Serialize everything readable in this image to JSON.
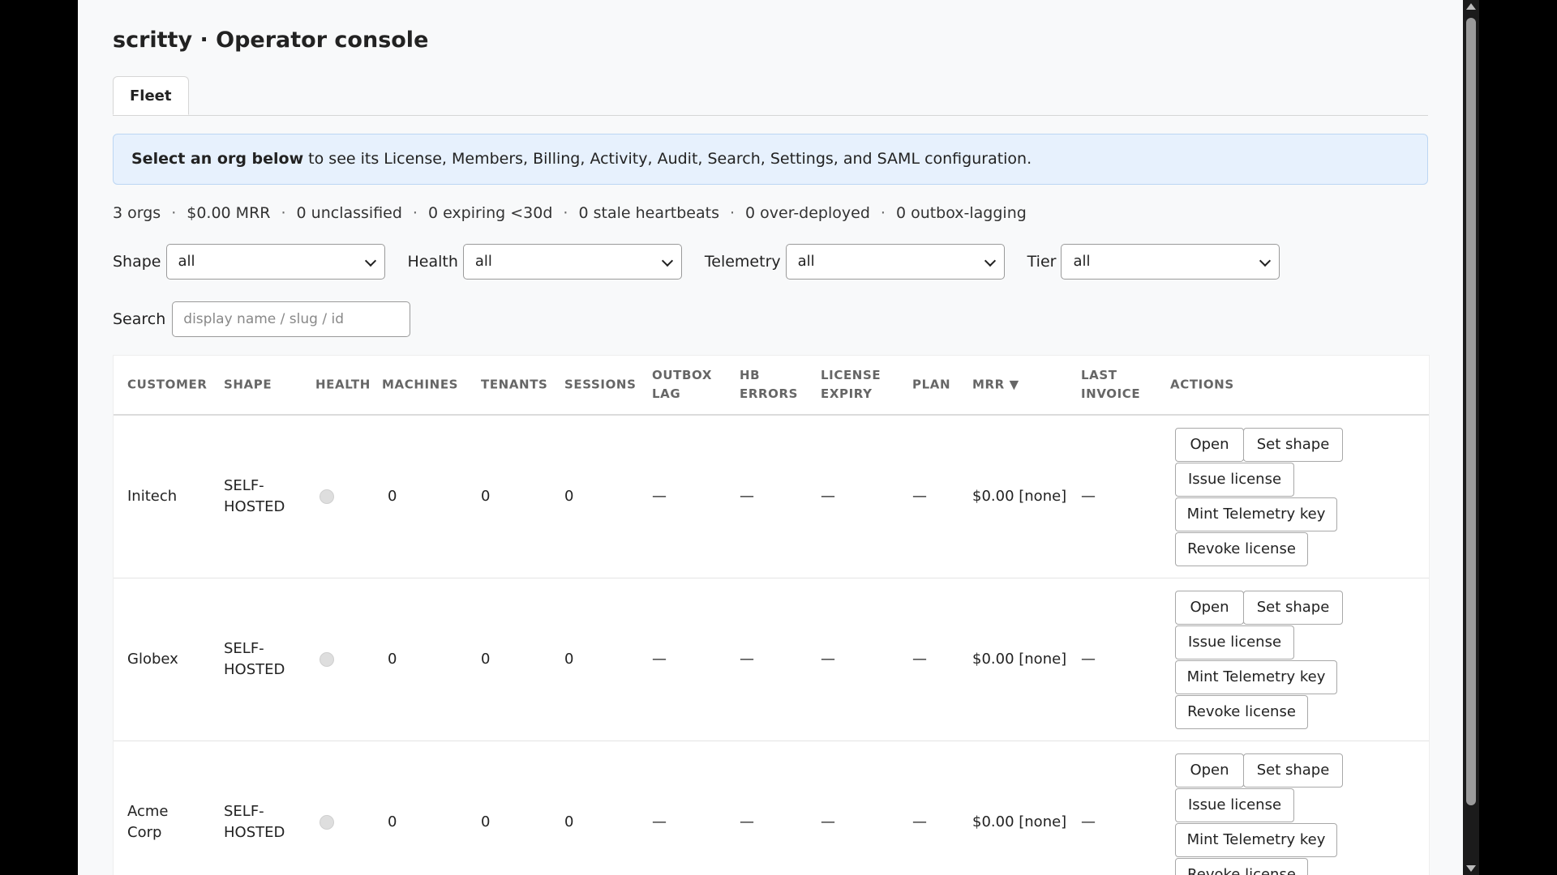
{
  "page": {
    "title": "scritty · Operator console"
  },
  "tabs": [
    {
      "label": "Fleet"
    }
  ],
  "info": {
    "bold": "Select an org below",
    "rest": " to see its License, Members, Billing, Activity, Audit, Search, Settings, and SAML configuration."
  },
  "stats": [
    "3 orgs",
    "$0.00 MRR",
    "0 unclassified",
    "0 expiring <30d",
    "0 stale heartbeats",
    "0 over-deployed",
    "0 outbox-lagging"
  ],
  "stats_separator": "·",
  "filters": [
    {
      "label": "Shape",
      "value": "all"
    },
    {
      "label": "Health",
      "value": "all"
    },
    {
      "label": "Telemetry",
      "value": "all"
    },
    {
      "label": "Tier",
      "value": "all"
    }
  ],
  "search": {
    "label": "Search",
    "placeholder": "display name / slug / id",
    "value": ""
  },
  "table": {
    "columns": [
      "CUSTOMER",
      "SHAPE",
      "HEALTH",
      "MACHINES",
      "TENANTS",
      "SESSIONS",
      "OUTBOX\nLAG",
      "HB\nERRORS",
      "LICENSE\nEXPIRY",
      "PLAN",
      "MRR ▼",
      "LAST\nINVOICE",
      "ACTIONS"
    ],
    "rows": [
      {
        "customer": "Initech",
        "shape": "SELF-\nHOSTED",
        "health": "unknown",
        "machines": "0",
        "tenants": "0",
        "sessions": "0",
        "outbox_lag": "—",
        "hb_errors": "—",
        "license_expiry": "—",
        "plan": "—",
        "mrr": "$0.00 [none]",
        "last_invoice": "—"
      },
      {
        "customer": "Globex",
        "shape": "SELF-\nHOSTED",
        "health": "unknown",
        "machines": "0",
        "tenants": "0",
        "sessions": "0",
        "outbox_lag": "—",
        "hb_errors": "—",
        "license_expiry": "—",
        "plan": "—",
        "mrr": "$0.00 [none]",
        "last_invoice": "—"
      },
      {
        "customer": "Acme\nCorp",
        "shape": "SELF-\nHOSTED",
        "health": "unknown",
        "machines": "0",
        "tenants": "0",
        "sessions": "0",
        "outbox_lag": "—",
        "hb_errors": "—",
        "license_expiry": "—",
        "plan": "—",
        "mrr": "$0.00 [none]",
        "last_invoice": "—"
      }
    ],
    "actions": {
      "open": "Open",
      "set_shape": "Set shape",
      "issue_license": "Issue license",
      "mint_telemetry_key": "Mint Telemetry key",
      "revoke_license": "Revoke license"
    }
  },
  "colors": {
    "info_bg": "#e7f1fd",
    "info_border": "#bcd6f3",
    "health_unknown": "#dedede"
  }
}
